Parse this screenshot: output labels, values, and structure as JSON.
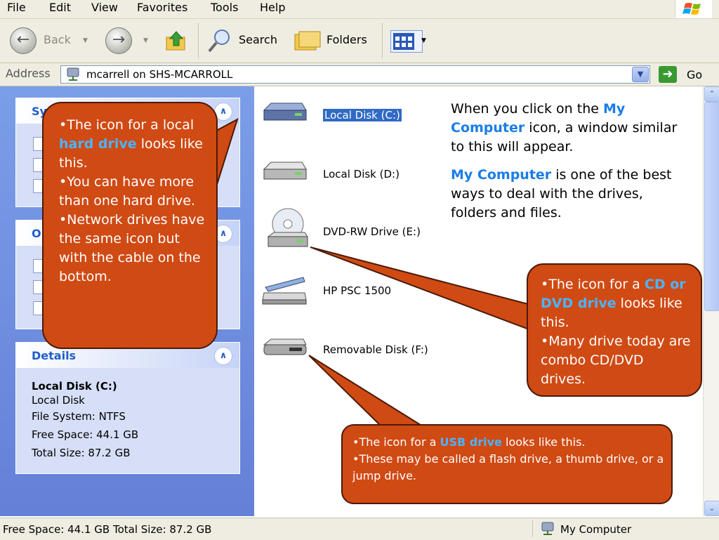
{
  "menu": [
    "File",
    "Edit",
    "View",
    "Favorites",
    "Tools",
    "Help"
  ],
  "toolbar": {
    "back_label": "Back",
    "search_label": "Search",
    "folders_label": "Folders"
  },
  "address": {
    "label": "Address",
    "value": "mcarrell on SHS-MCARROLL",
    "go_label": "Go"
  },
  "taskpane": {
    "system_title_partial": "Sy",
    "other_title_partial": "O",
    "details": {
      "title": "Details",
      "name": "Local Disk (C:)",
      "type": "Local Disk",
      "filesystem": "File System: NTFS",
      "free": "Free Space: 44.1 GB",
      "total": "Total Size: 87.2 GB"
    }
  },
  "drives": [
    {
      "label": "Local Disk (C:)",
      "icon": "hard-drive-network-icon",
      "selected": true
    },
    {
      "label": "Local Disk (D:)",
      "icon": "hard-drive-icon",
      "selected": false
    },
    {
      "label": "DVD-RW Drive (E:)",
      "icon": "dvd-drive-icon",
      "selected": false
    },
    {
      "label": "HP PSC 1500",
      "icon": "scanner-icon",
      "selected": false
    },
    {
      "label": "Removable Disk (F:)",
      "icon": "removable-disk-icon",
      "selected": false
    }
  ],
  "statusbar": {
    "left": "Free Space: 44.1 GB Total Size: 87.2 GB",
    "right": "My Computer"
  },
  "info": {
    "p1_a": "When you click on the ",
    "p1_b": "My Computer",
    "p1_c": " icon, a window similar to this will appear.",
    "p2_a": "My Computer",
    "p2_b": " is one of the best ways to deal with the drives, folders and files."
  },
  "callouts": {
    "harddrive": {
      "l1_a": "•The icon for a local ",
      "l1_b": "hard drive",
      "l1_c": " looks like this.",
      "l2": "•You can have more than one hard drive.",
      "l3": "•Network drives have the same icon but with the cable on the bottom."
    },
    "dvd": {
      "l1_a": "•The icon for a ",
      "l1_b": "CD or DVD drive",
      "l1_c": " looks like this.",
      "l2": "•Many drive today are combo CD/DVD drives."
    },
    "usb": {
      "l1_a": "•The icon for a ",
      "l1_b": "USB drive",
      "l1_c": " looks like this.",
      "l2": "•These may be called a flash drive, a thumb drive, or a jump drive."
    }
  },
  "colors": {
    "callout_fill": "#d04a14",
    "highlight": "#4ab4ff",
    "selection": "#316ac5",
    "pane_blue": "#6480d8"
  }
}
